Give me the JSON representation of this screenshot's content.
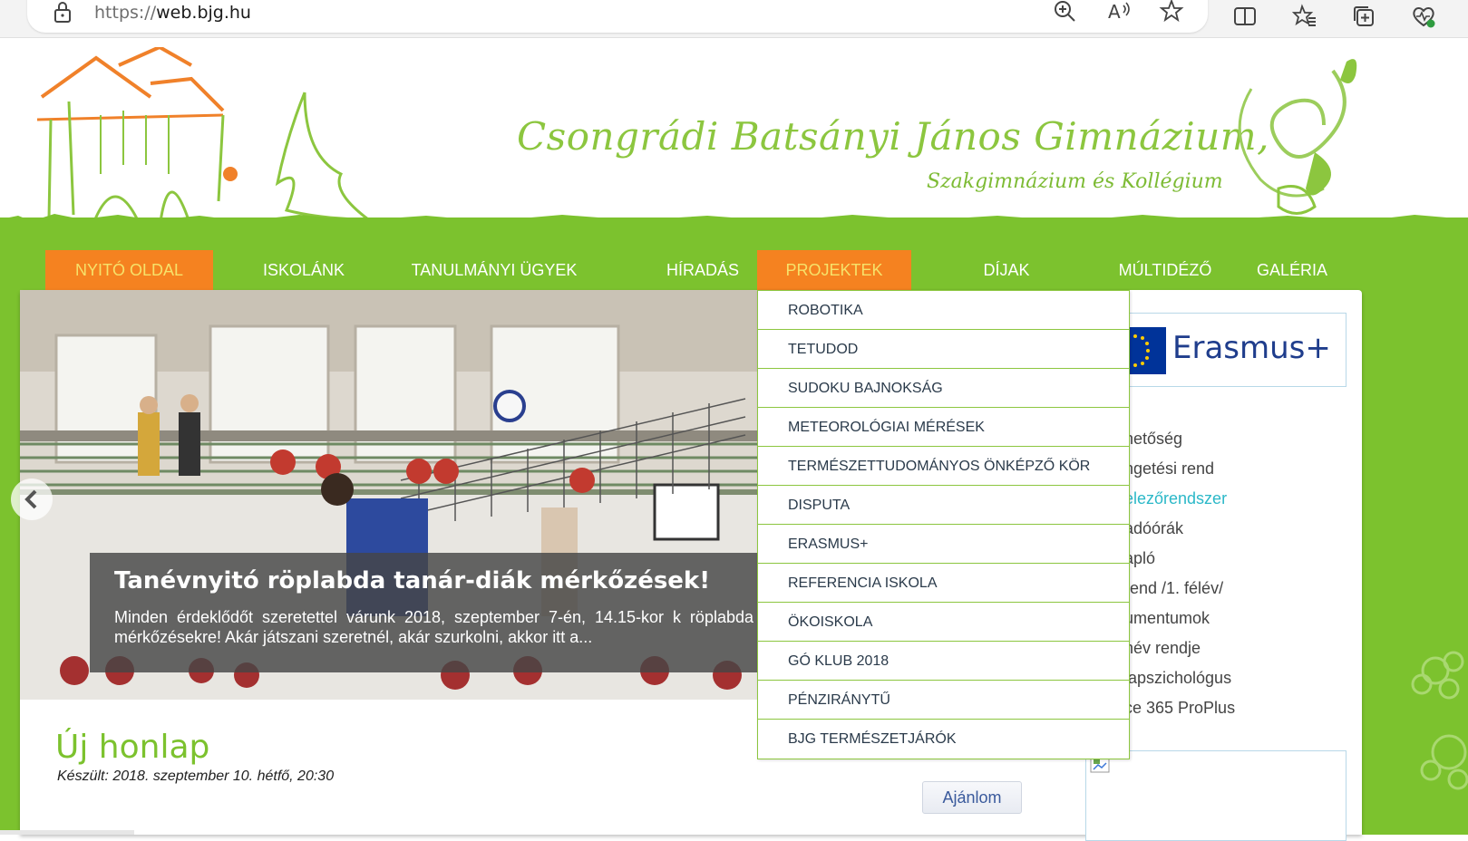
{
  "browser": {
    "url_protocol": "https://",
    "url_host": "web.bjg.hu",
    "icons": [
      "lock-icon",
      "zoom-icon",
      "read-aloud-icon",
      "favorite-star-icon",
      "split-screen-icon",
      "favorites-icon",
      "collections-icon",
      "browser-essentials-icon"
    ]
  },
  "header": {
    "title": "Csongrádi Batsányi János Gimnázium,",
    "subtitle": "Szakgimnázium és Kollégium"
  },
  "nav": {
    "items": [
      {
        "label": "NYITÓ OLDAL",
        "active": true
      },
      {
        "label": "ISKOLÁNK",
        "active": false
      },
      {
        "label": "TANULMÁNYI ÜGYEK",
        "active": false
      },
      {
        "label": "HÍRADÁS",
        "active": false
      },
      {
        "label": "PROJEKTEK",
        "active": true
      },
      {
        "label": "DÍJAK",
        "active": false
      },
      {
        "label": "MÚLTIDÉZŐ",
        "active": false
      },
      {
        "label": "GALÉRIA",
        "active": false
      }
    ]
  },
  "dropdown": {
    "items": [
      "ROBOTIKA",
      "TETUDOD",
      "SUDOKU BAJNOKSÁG",
      "METEOROLÓGIAI MÉRÉSEK",
      "TERMÉSZETTUDOMÁNYOS ÖNKÉPZŐ KÖR",
      "DISPUTA",
      "ERASMUS+",
      "REFERENCIA ISKOLA",
      "ÖKOISKOLA",
      "GÓ KLUB 2018",
      "PÉNZIRÁNYTŰ",
      "BJG TERMÉSZETJÁRÓK"
    ]
  },
  "slider": {
    "caption_title": "Tanévnyitó röplabda tanár-diák mérkőzések!",
    "caption_text": "Minden érdeklődőt szeretettel várunk 2018, szeptember 7-én, 14.15-kor k röplabda mérkőzésekre! Akár játszani szeretnél, akár szurkolni, akkor itt a..."
  },
  "article": {
    "title": "Új honlap",
    "date": "Készült: 2018. szeptember 10. hétfő, 20:30",
    "recommend_label": "Ajánlom"
  },
  "sidebar": {
    "erasmus_label": "Erasmus+",
    "links": [
      {
        "label": "hetőség",
        "highlight": false
      },
      {
        "label": "ngetési rend",
        "highlight": false
      },
      {
        "label": "elezőrendszer",
        "highlight": true
      },
      {
        "label": "adóórák",
        "highlight": false
      },
      {
        "label": "apló",
        "highlight": false
      },
      {
        "label": "rend /1. félév/",
        "highlight": false
      },
      {
        "label": "umentumok",
        "highlight": false
      },
      {
        "label": "név rendje",
        "highlight": false
      },
      {
        "label": "lapszichológus",
        "highlight": false
      },
      {
        "label": "ce 365 ProPlus",
        "highlight": false
      }
    ]
  },
  "colors": {
    "green": "#7cc22e",
    "orange": "#f58220",
    "title_green": "#8cc63f",
    "link_cyan": "#2bb8c8"
  }
}
